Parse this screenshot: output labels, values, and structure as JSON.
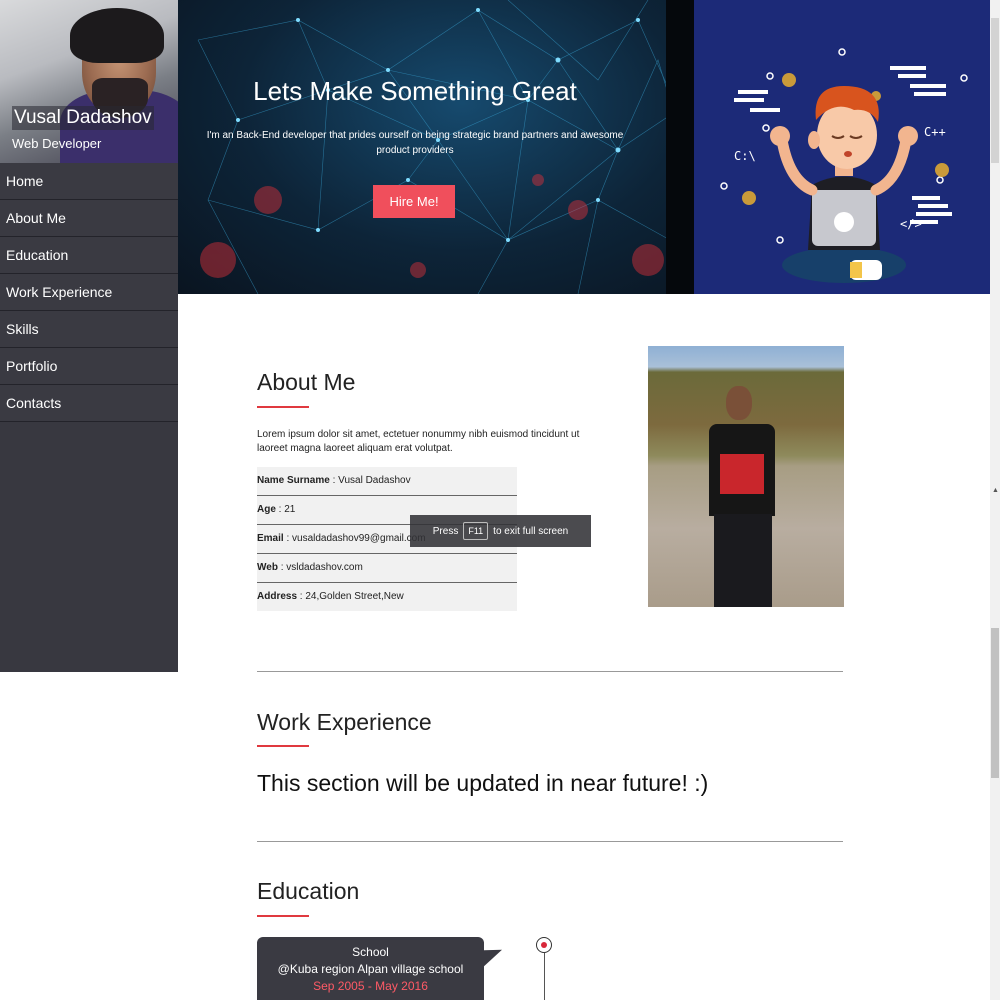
{
  "sidebar": {
    "name": "Vusal Dadashov",
    "role": "Web Developer",
    "items": [
      {
        "label": "Home"
      },
      {
        "label": "About Me"
      },
      {
        "label": "Education"
      },
      {
        "label": "Work Experience"
      },
      {
        "label": "Skills"
      },
      {
        "label": "Portfolio"
      },
      {
        "label": "Contacts"
      }
    ]
  },
  "hero": {
    "title": "Lets Make Something Great",
    "subtitle": "I'm an Back-End developer that prides ourself on being strategic brand partners and awesome product providers",
    "button_label": "Hire Me!",
    "accent_color": "#f04f5c"
  },
  "about": {
    "title": "About Me",
    "text": "Lorem ipsum dolor sit amet, ectetuer nonummy nibh euismod tincidunt ut laoreet magna laoreet aliquam erat volutpat.",
    "rows": [
      {
        "label": "Name Surname",
        "value": " : Vusal Dadashov"
      },
      {
        "label": "Age",
        "value": " : 21"
      },
      {
        "label": "Email",
        "value": " : vusaldadashov99@gmail.com"
      },
      {
        "label": "Web",
        "value": " : vsldadashov.com"
      },
      {
        "label": "Address",
        "value": " : 24,Golden Street,New"
      }
    ]
  },
  "toast": {
    "prefix": "Press",
    "key": "F11",
    "suffix": "to exit full screen"
  },
  "work": {
    "title": "Work Experience",
    "message": "This section will be updated in near future! :)"
  },
  "education": {
    "title": "Education",
    "items": [
      {
        "label": "School",
        "place": "@Kuba region Alpan village school",
        "date": "Sep 2005 - May 2016"
      }
    ]
  },
  "colors": {
    "sidebar_bg": "#383840",
    "accent_red": "#e0393f",
    "illustration_bg": "#1c2a78"
  }
}
